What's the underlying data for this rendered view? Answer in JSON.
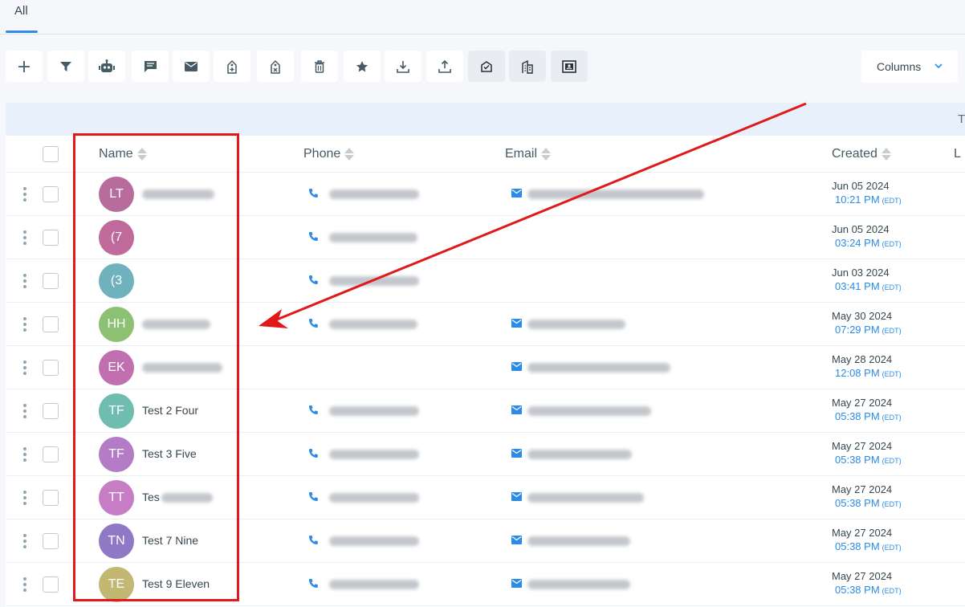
{
  "tabs": [
    {
      "label": "All",
      "active": true
    }
  ],
  "toolbar": {
    "buttons": [
      {
        "name": "add-button",
        "icon": "plus-icon"
      },
      {
        "name": "filter-button",
        "icon": "filter-icon"
      },
      {
        "name": "bot-button",
        "icon": "robot-icon"
      },
      {
        "name": "message-button",
        "icon": "chat-icon"
      },
      {
        "name": "email-button",
        "icon": "envelope-icon"
      },
      {
        "name": "tag-add-button",
        "icon": "tag-plus-icon"
      },
      {
        "name": "tag-remove-button",
        "icon": "tag-remove-icon"
      },
      {
        "name": "delete-button",
        "icon": "trash-icon"
      },
      {
        "name": "favorite-button",
        "icon": "star-icon"
      },
      {
        "name": "import-button",
        "icon": "download-icon"
      },
      {
        "name": "export-button",
        "icon": "upload-icon"
      },
      {
        "name": "mail-check-button",
        "icon": "mail-check-icon"
      },
      {
        "name": "company-button",
        "icon": "building-icon"
      },
      {
        "name": "card-button",
        "icon": "id-card-icon"
      }
    ],
    "columns_label": "Columns"
  },
  "band_text": "T",
  "table": {
    "columns": {
      "name": "Name",
      "phone": "Phone",
      "email": "Email",
      "created": "Created",
      "last": "L"
    },
    "rows": [
      {
        "initials": "LT",
        "color": "#b86c9c",
        "name": "",
        "has_phone": true,
        "has_email": true,
        "date": "Jun 05 2024",
        "time": "10:21 PM",
        "tz": "(EDT)"
      },
      {
        "initials": "(7",
        "color": "#c0699b",
        "name": "",
        "has_phone": true,
        "has_email": false,
        "date": "Jun 05 2024",
        "time": "03:24 PM",
        "tz": "(EDT)"
      },
      {
        "initials": "(3",
        "color": "#6fb2bd",
        "name": "",
        "has_phone": true,
        "has_email": false,
        "date": "Jun 03 2024",
        "time": "03:41 PM",
        "tz": "(EDT)"
      },
      {
        "initials": "HH",
        "color": "#8cc173",
        "name": "",
        "has_phone": true,
        "has_email": true,
        "date": "May 30 2024",
        "time": "07:29 PM",
        "tz": "(EDT)"
      },
      {
        "initials": "EK",
        "color": "#c16fae",
        "name": "",
        "has_phone": false,
        "has_email": true,
        "date": "May 28 2024",
        "time": "12:08 PM",
        "tz": "(EDT)"
      },
      {
        "initials": "TF",
        "color": "#6fbcb0",
        "name": "Test 2 Four",
        "has_phone": true,
        "has_email": true,
        "date": "May 27 2024",
        "time": "05:38 PM",
        "tz": "(EDT)"
      },
      {
        "initials": "TF",
        "color": "#b47cc6",
        "name": "Test 3 Five",
        "has_phone": true,
        "has_email": true,
        "date": "May 27 2024",
        "time": "05:38 PM",
        "tz": "(EDT)"
      },
      {
        "initials": "TT",
        "color": "#c77cc6",
        "name": "Tes",
        "has_phone": true,
        "has_email": true,
        "date": "May 27 2024",
        "time": "05:38 PM",
        "tz": "(EDT)"
      },
      {
        "initials": "TN",
        "color": "#8f78c4",
        "name": "Test 7 Nine",
        "has_phone": true,
        "has_email": true,
        "date": "May 27 2024",
        "time": "05:38 PM",
        "tz": "(EDT)"
      },
      {
        "initials": "TE",
        "color": "#c3b873",
        "name": "Test 9 Eleven",
        "has_phone": true,
        "has_email": true,
        "date": "May 27 2024",
        "time": "05:38 PM",
        "tz": "(EDT)"
      }
    ]
  },
  "colors": {
    "accent": "#2b8be6",
    "annotation": "#e01a1a"
  }
}
